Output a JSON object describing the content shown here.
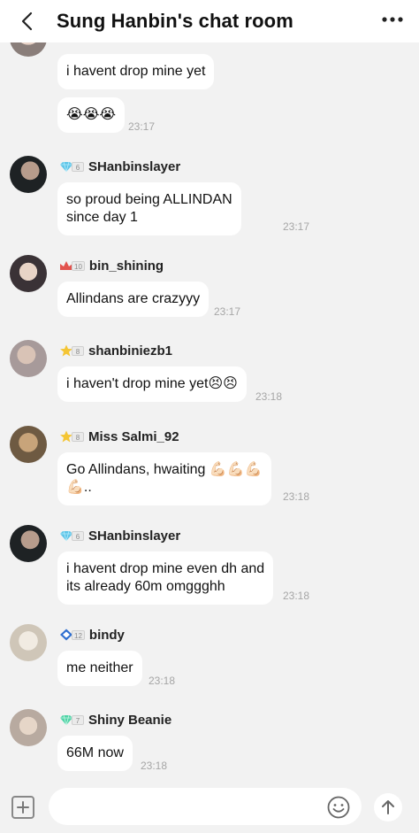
{
  "header": {
    "title": "Sung Hanbin's chat room",
    "back_icon": "chevron-left-icon",
    "more_icon": "more-horizontal-icon"
  },
  "messages": [
    {
      "sender": "",
      "level": "",
      "badge": "",
      "lines": [
        "i havent drop mine yet"
      ],
      "time": ""
    },
    {
      "sender": "",
      "level": "",
      "badge": "",
      "lines": [
        "😭😭😭"
      ],
      "time": "23:17"
    },
    {
      "sender": "SHanbinslayer",
      "level": "6",
      "badge": "diamond-blue",
      "lines": [
        "so proud being ALLINDAN",
        "since day 1"
      ],
      "time": "23:17"
    },
    {
      "sender": "bin_shining",
      "level": "10",
      "badge": "crown-red",
      "lines": [
        "Allindans are crazyyy"
      ],
      "time": "23:17"
    },
    {
      "sender": "shanbiniezb1",
      "level": "8",
      "badge": "star-gold",
      "lines": [
        "i haven't drop mine yet😣😣"
      ],
      "time": "23:18"
    },
    {
      "sender": "Miss Salmi_92",
      "level": "8",
      "badge": "star-gold",
      "lines": [
        "Go Allindans, hwaiting 💪🏻💪🏻💪🏻",
        "💪🏻.."
      ],
      "time": "23:18"
    },
    {
      "sender": "SHanbinslayer",
      "level": "6",
      "badge": "diamond-blue",
      "lines": [
        "i havent drop mine even dh and",
        "its already 60m omggghh"
      ],
      "time": "23:18"
    },
    {
      "sender": "bindy",
      "level": "12",
      "badge": "diamond-frame",
      "lines": [
        "me neither"
      ],
      "time": "23:18"
    },
    {
      "sender": "Shiny Beanie",
      "level": "7",
      "badge": "diamond-green",
      "lines": [
        "66M now"
      ],
      "time": "23:18"
    }
  ],
  "input_bar": {
    "placeholder": "",
    "plus_icon": "plus-square-icon",
    "emoji_icon": "smiley-icon",
    "send_icon": "arrow-up-icon"
  },
  "colors": {
    "background": "#f2f2f2",
    "bubble": "#ffffff",
    "timestamp": "#a6a6a6",
    "badge_blue": "#5ec5e8",
    "badge_red": "#e2534e",
    "badge_gold": "#f4c534",
    "badge_green": "#4fd3a6"
  }
}
